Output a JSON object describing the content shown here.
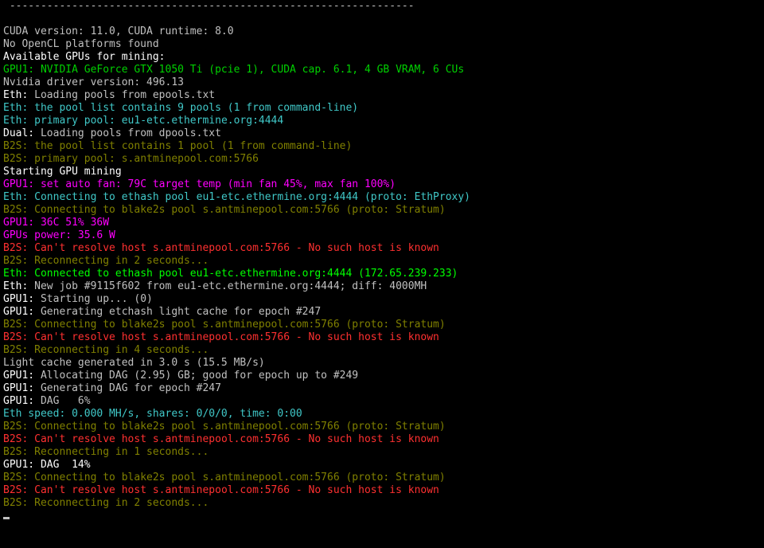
{
  "term": {
    "divider": " -----------------------------------------------------------------",
    "blank": "",
    "cuda": "CUDA version: 11.0, CUDA runtime: 8.0",
    "noopencl": "No OpenCL platforms found",
    "avail": "Available GPUs for mining:",
    "gpu1name": "GPU1: NVIDIA GeForce GTX 1050 Ti (pcie 1), CUDA cap. 6.1, 4 GB VRAM, 6 CUs",
    "drv": "Nvidia driver version: 496.13",
    "ethlabel": "Eth:",
    "ethload": " Loading pools from epools.txt",
    "ethlist": " the pool list contains 9 pools (1 from command-line)",
    "ethprim": " primary pool: eu1-etc.ethermine.org:4444",
    "duallabel": "Dual:",
    "dualload": " Loading pools from dpools.txt",
    "b2slabel": "B2S:",
    "b2slist": " the pool list contains 1 pool (1 from command-line)",
    "b2sprim": " primary pool: s.antminepool.com:5766",
    "start": "Starting GPU mining",
    "gpu1label": "GPU1:",
    "fan": " set auto fan: 79C target temp (min fan 45%, max fan 100%)",
    "ethconn1": " Connecting to ethash pool eu1-etc.ethermine.org:4444 (proto: EthProxy)",
    "b2sconn": " Connecting to blake2s pool s.antminepool.com:5766 (proto: Stratum)",
    "gpu1temp": "GPU1: 36C 51% 36W",
    "power": "GPUs power: 35.6 W",
    "b2serr": " Can't resolve host s.antminepool.com:5766 - No such host is known",
    "b2sre2": " Reconnecting in 2 seconds...",
    "b2sre4": " Reconnecting in 4 seconds...",
    "b2sre1": " Reconnecting in 1 seconds...",
    "ethok": " Connected to ethash pool eu1-etc.ethermine.org:4444 (172.65.239.233)",
    "ethjob": " New job #9115f602 from eu1-etc.ethermine.org:4444; diff: 4000MH",
    "gpu1start": " Starting up... (0)",
    "gpu1cache": " Generating etchash light cache for epoch #247",
    "lightcache": "Light cache generated in 3.0 s (15.5 MB/s)",
    "gpu1alloc": " Allocating DAG (2.95) GB; good for epoch up to #249",
    "gpu1gendag": " Generating DAG for epoch #247",
    "gpu1dag6": " DAG   6%",
    "ethspeed": "Eth speed: 0.000 MH/s, shares: 0/0/0, time: 0:00",
    "gpu1dag14": " DAG  14%"
  }
}
